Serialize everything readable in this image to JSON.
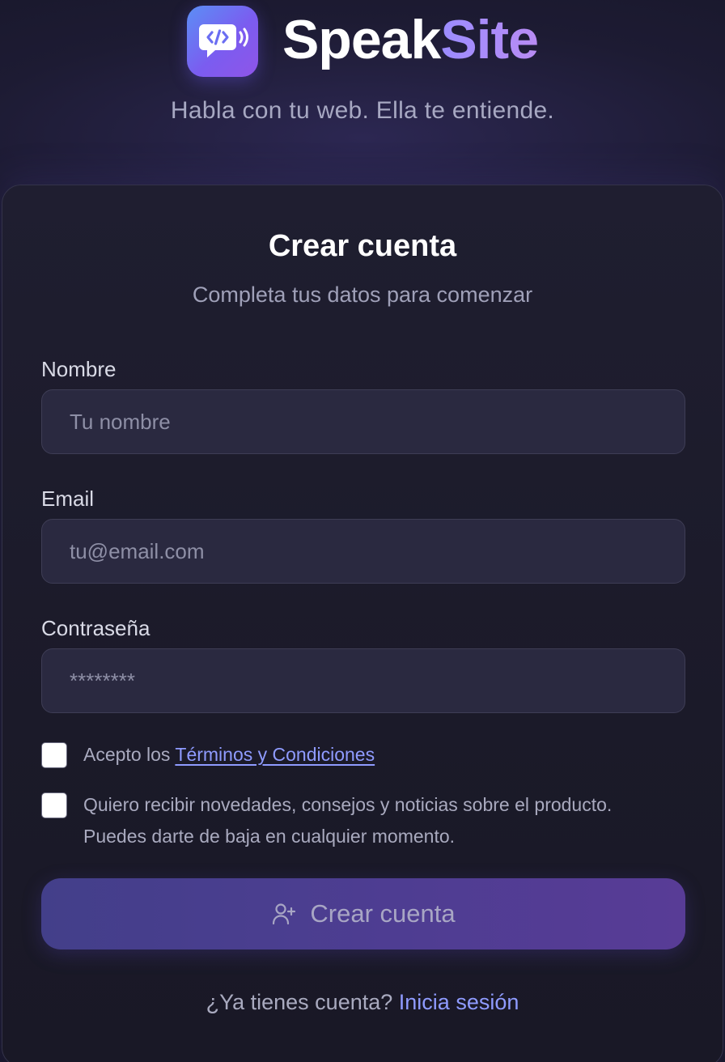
{
  "brand": {
    "name_part1": "Speak",
    "name_part2": "Site",
    "tagline": "Habla con tu web. Ella te entiende.",
    "icon": "speech-bubble-code-icon"
  },
  "form": {
    "title": "Crear cuenta",
    "subtitle": "Completa tus datos para comenzar",
    "name": {
      "label": "Nombre",
      "placeholder": "Tu nombre",
      "value": ""
    },
    "email": {
      "label": "Email",
      "placeholder": "tu@email.com",
      "value": ""
    },
    "password": {
      "label": "Contraseña",
      "placeholder": "********",
      "value": ""
    },
    "terms": {
      "checked": false,
      "prefix": "Acepto los",
      "link": "Términos y Condiciones"
    },
    "newsletter": {
      "checked": false,
      "line1": "Quiero recibir novedades, consejos y noticias sobre el producto.",
      "line2": "Puedes darte de baja en cualquier momento."
    },
    "submit": {
      "label": "Crear cuenta",
      "icon": "user-plus-icon"
    }
  },
  "footer": {
    "prompt": "¿Ya tienes cuenta?",
    "link": "Inicia sesión"
  },
  "colors": {
    "accent": "#8f9bff",
    "button_gradient_start": "#433f8a",
    "button_gradient_end": "#583c96"
  }
}
